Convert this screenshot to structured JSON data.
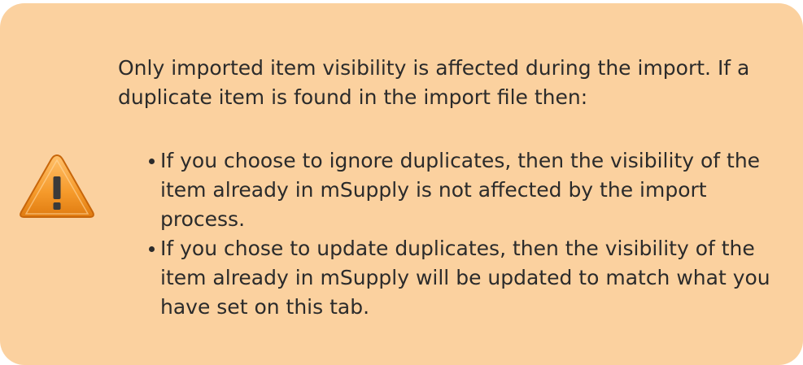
{
  "note": {
    "icon": "warning-icon",
    "background_color": "#fbd19f",
    "intro": "Only imported item visibility is affected during the import. If a duplicate item is found in the import file then:",
    "bullets": [
      "If you choose to ignore duplicates, then the visibility of the item already in mSupply is not affected by the import process.",
      "If you chose to update duplicates, then the visibility of the item already in mSupply will be updated to match what you have set on this tab."
    ]
  }
}
